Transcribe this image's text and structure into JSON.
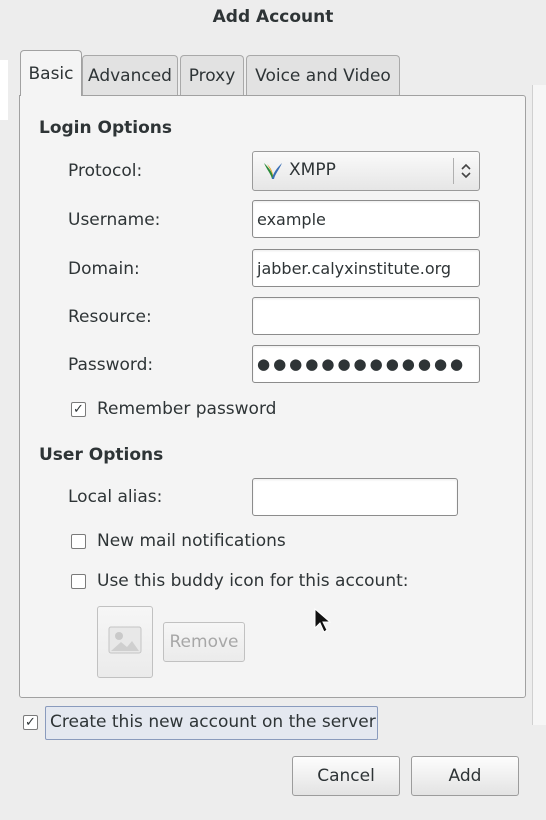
{
  "window": {
    "title": "Add Account"
  },
  "tabs": [
    {
      "label": "Basic",
      "active": true
    },
    {
      "label": "Advanced",
      "active": false
    },
    {
      "label": "Proxy",
      "active": false
    },
    {
      "label": "Voice and Video",
      "active": false
    }
  ],
  "login_options": {
    "heading": "Login Options",
    "protocol": {
      "label": "Protocol:",
      "value": "XMPP",
      "icon": "xmpp-logo-icon"
    },
    "username": {
      "label": "Username:",
      "value": "example"
    },
    "domain": {
      "label": "Domain:",
      "value": "jabber.calyxinstitute.org"
    },
    "resource": {
      "label": "Resource:",
      "value": ""
    },
    "password": {
      "label": "Password:",
      "value": "●●●●●●●●●●●●●"
    },
    "remember_password": {
      "label": "Remember password",
      "checked": true
    }
  },
  "user_options": {
    "heading": "User Options",
    "local_alias": {
      "label": "Local alias:",
      "value": ""
    },
    "new_mail": {
      "label": "New mail notifications",
      "checked": false
    },
    "buddy_icon": {
      "label": "Use this buddy icon for this account:",
      "checked": false
    },
    "remove_label": "Remove"
  },
  "create_on_server": {
    "label": "Create this new account on the server",
    "checked": true
  },
  "buttons": {
    "cancel": "Cancel",
    "add": "Add"
  },
  "check_glyph": "✓",
  "colors": {
    "window_bg": "#ededed",
    "focus_outline": "#8a9bbd"
  }
}
